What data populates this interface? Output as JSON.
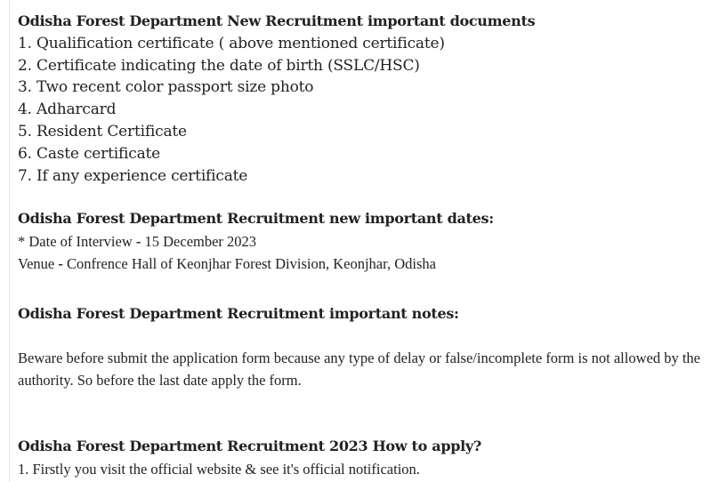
{
  "documents_section": {
    "heading": "Odisha Forest Department New Recruitment important documents",
    "items": [
      "1. Qualification certificate ( above mentioned certificate)",
      "2. Certificate indicating  the  date of birth (SSLC/HSC)",
      "3. Two recent color passport size photo",
      "4. Adharcard",
      "5. Resident Certificate",
      "6. Caste certificate",
      "7. If any experience certificate"
    ]
  },
  "dates_section": {
    "heading": "Odisha Forest Department Recruitment new important dates:",
    "interview_prefix": "*  Date of Interview ",
    "interview_sep": "-",
    "interview_date": " 15 December 2023",
    "venue_label": "Venue ",
    "venue_sep": "-",
    "venue_value": " Confrence Hall of Keonjhar Forest Division, Keonjhar, Odisha"
  },
  "notes_section": {
    "heading": "Odisha Forest Department Recruitment important notes:",
    "text": "Beware before submit the application form because any type of delay or false/incomplete form is not allowed by the authority. So before the last date apply the form."
  },
  "apply_section": {
    "heading": "Odisha Forest Department Recruitment 2023 How to apply?",
    "steps": [
      "1. Firstly you visit the official website & see it's official notification."
    ]
  }
}
